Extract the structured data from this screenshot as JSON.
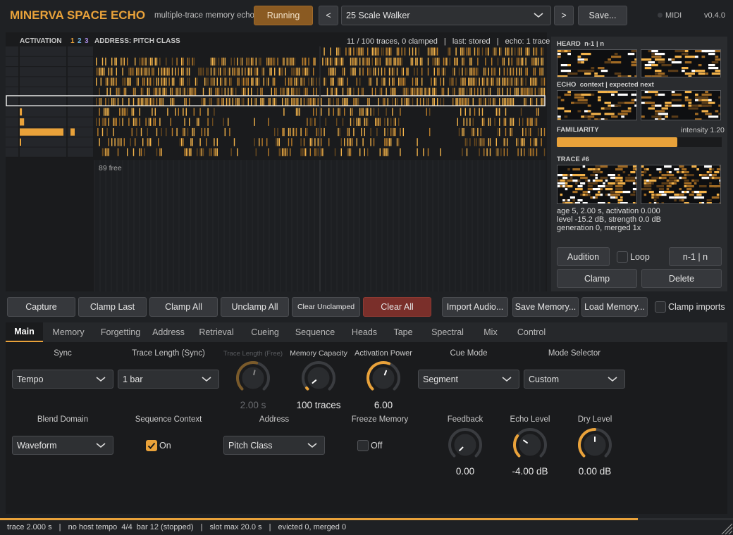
{
  "header": {
    "title": "MINERVA SPACE ECHO",
    "subtitle": "multiple-trace memory echo",
    "run_label": "Running",
    "prev_label": "<",
    "preset": "25 Scale Walker",
    "next_label": ">",
    "save_label": "Save...",
    "midi_label": "MIDI",
    "version": "v0.4.0"
  },
  "grid": {
    "activation_label": "ACTIVATION",
    "n1": "1",
    "n2": "2",
    "n3": "3",
    "address_label": "ADDRESS: PITCH CLASS",
    "status_traces": "11 / 100 traces, 0 clamped",
    "sep": "|",
    "status_last": "last: stored",
    "status_echo": "echo: 1 trace",
    "free_label": "89 free",
    "activation_levels": [
      0.0,
      0.0,
      0.0,
      0.0,
      0.0,
      0.0,
      0.05,
      0.1,
      1.0,
      0.02,
      0.0
    ]
  },
  "side": {
    "heard_label": "HEARD",
    "heard_sub": "n-1 | n",
    "echo_label": "ECHO",
    "echo_sub": "context | expected next",
    "familiarity_label": "FAMILIARITY",
    "intensity_label": "intensity 1.20",
    "familiarity_level": 0.73,
    "trace_label": "TRACE #6",
    "trace_line1": "age 5, 2.00 s, activation 0.000",
    "trace_line2": "level -15.2 dB, strength 0.0 dB",
    "trace_line3": "generation 0, merged 1x",
    "audition_label": "Audition",
    "loop_label": "Loop",
    "nn_label": "n-1 | n",
    "clamp_label": "Clamp",
    "delete_label": "Delete"
  },
  "actions": {
    "capture": "Capture",
    "clamp_last": "Clamp Last",
    "clamp_all": "Clamp All",
    "unclamp_all": "Unclamp All",
    "clear_unclamped": "Clear Unclamped",
    "clear_all": "Clear All",
    "import_audio": "Import Audio...",
    "save_memory": "Save Memory...",
    "load_memory": "Load Memory...",
    "clamp_imports": "Clamp imports"
  },
  "tabs": [
    "Main",
    "Memory",
    "Forgetting",
    "Address",
    "Retrieval",
    "Cueing",
    "Sequence",
    "Heads",
    "Tape",
    "Spectral",
    "Mix",
    "Control"
  ],
  "main": {
    "sync_label": "Sync",
    "sync_value": "Tempo",
    "trace_len_sync_label": "Trace Length (Sync)",
    "trace_len_sync_value": "1 bar",
    "trace_len_free_label": "Trace Length (Free)",
    "trace_len_free_value": "2.00 s",
    "memory_capacity_label": "Memory Capacity",
    "memory_capacity_value": "100 traces",
    "activation_power_label": "Activation Power",
    "activation_power_value": "6.00",
    "cue_mode_label": "Cue Mode",
    "cue_mode_value": "Segment",
    "mode_selector_label": "Mode Selector",
    "mode_selector_value": "Custom",
    "blend_domain_label": "Blend Domain",
    "blend_domain_value": "Waveform",
    "sequence_context_label": "Sequence Context",
    "sequence_context_value": "On",
    "address_label": "Address",
    "address_value": "Pitch Class",
    "freeze_memory_label": "Freeze Memory",
    "freeze_memory_value": "Off",
    "feedback_label": "Feedback",
    "feedback_value": "0.00",
    "echo_level_label": "Echo Level",
    "echo_level_value": "-4.00 dB",
    "dry_level_label": "Dry Level",
    "dry_level_value": "0.00 dB"
  },
  "status": {
    "trace": "trace 2.000 s",
    "tempo": "no host tempo  4/4  bar 12 (stopped)",
    "slot": "slot max 20.0 s",
    "evicted": "evicted 0, merged 0",
    "sep": "|",
    "progress": 0.87
  },
  "colors": {
    "accent": "#e9a23a",
    "running_bg": "#8a5a22",
    "clear_all_bg": "#7a2f2a",
    "n2": "#6fb3e0",
    "n3": "#a58ae0"
  }
}
